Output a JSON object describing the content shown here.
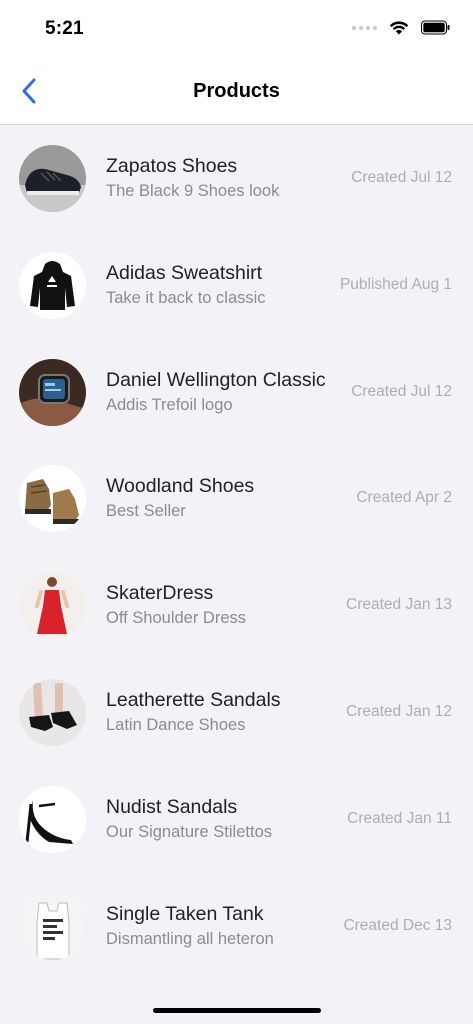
{
  "status_bar": {
    "time": "5:21"
  },
  "nav": {
    "title": "Products",
    "back_icon": "chevron-left-icon",
    "accent_color": "#2f6fde"
  },
  "products": [
    {
      "title": "Zapatos Shoes",
      "subtitle": "The Black 9 Shoes look",
      "meta": "Created Jul 12"
    },
    {
      "title": "Adidas Sweatshirt",
      "subtitle": "Take it back to classic",
      "meta": "Published Aug 1"
    },
    {
      "title": "Daniel Wellington Classic",
      "subtitle": "Addis Trefoil logo",
      "meta": "Created Jul 12"
    },
    {
      "title": "Woodland Shoes",
      "subtitle": "Best Seller",
      "meta": "Created Apr 2"
    },
    {
      "title": "SkaterDress",
      "subtitle": "Off Shoulder Dress",
      "meta": "Created Jan 13"
    },
    {
      "title": "Leatherette Sandals",
      "subtitle": "Latin Dance Shoes",
      "meta": "Created Jan 12"
    },
    {
      "title": "Nudist Sandals",
      "subtitle": "Our Signature Stilettos",
      "meta": "Created Jan 11"
    },
    {
      "title": "Single Taken Tank",
      "subtitle": "Dismantling all heteron",
      "meta": "Created Dec 13"
    }
  ]
}
